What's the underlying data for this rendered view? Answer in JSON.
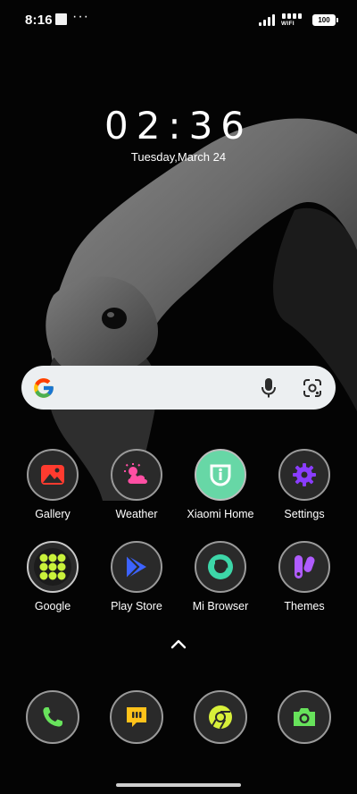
{
  "status_bar": {
    "time": "8:16",
    "battery": "100",
    "wifi_label": "WIFI",
    "more_icon": "more-dots-icon"
  },
  "clock": {
    "time": "02:36",
    "date": "Tuesday,March 24"
  },
  "search": {
    "logo_icon": "google-g-icon",
    "mic_icon": "microphone-icon",
    "lens_icon": "google-lens-icon"
  },
  "apps": [
    {
      "label": "Gallery",
      "icon": "gallery-icon",
      "color": "#ff3b2f"
    },
    {
      "label": "Weather",
      "icon": "weather-icon",
      "color": "#ff4fa3"
    },
    {
      "label": "Xiaomi Home",
      "icon": "xiaomi-home-icon",
      "color": "#67d7a6"
    },
    {
      "label": "Settings",
      "icon": "settings-gear-icon",
      "color": "#8a3dff"
    },
    {
      "label": "Google",
      "icon": "google-folder-icon",
      "color": "#c9f23b"
    },
    {
      "label": "Play Store",
      "icon": "play-store-icon",
      "color": "#3c63ff"
    },
    {
      "label": "Mi Browser",
      "icon": "browser-icon",
      "color": "#3dd6a8"
    },
    {
      "label": "Themes",
      "icon": "themes-icon",
      "color": "#b05cff"
    }
  ],
  "dock": [
    {
      "icon": "phone-icon",
      "color": "#68e35c"
    },
    {
      "icon": "messages-icon",
      "color": "#ffc21a"
    },
    {
      "icon": "chrome-icon",
      "color": "#d8f03a"
    },
    {
      "icon": "camera-icon",
      "color": "#67e25b"
    }
  ]
}
